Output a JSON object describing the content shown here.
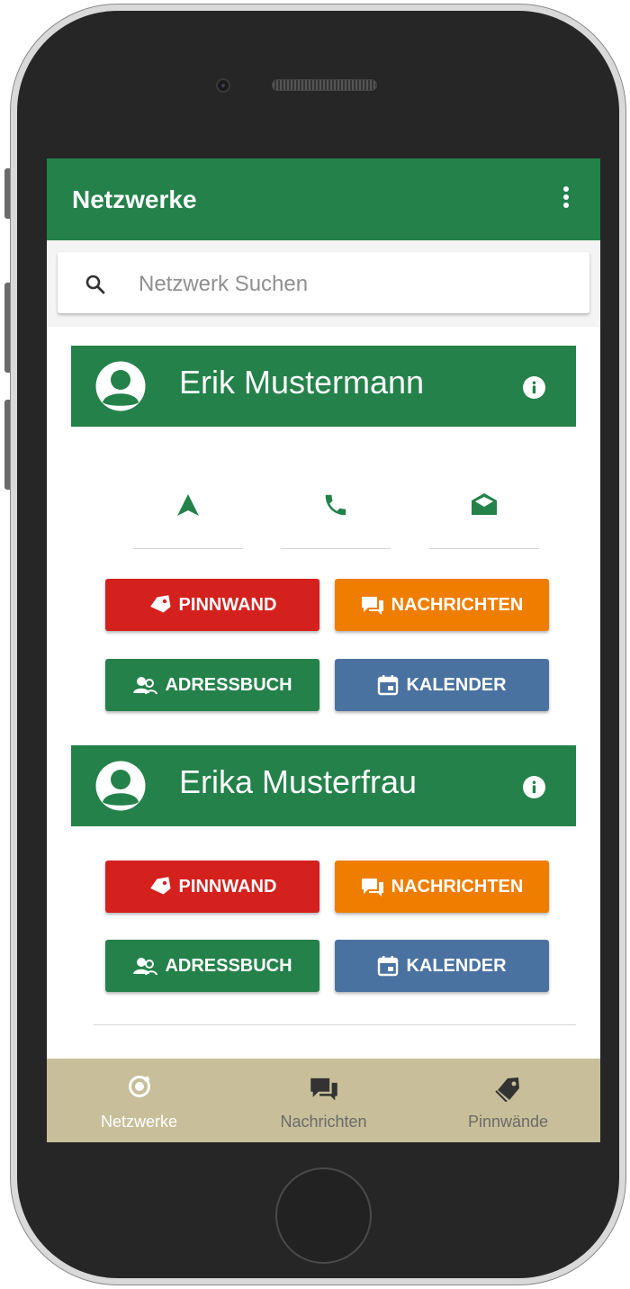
{
  "app": {
    "title": "Netzwerke",
    "menu_icon": "more-vertical-icon",
    "colors": {
      "primary": "#24814a",
      "red": "#d4211e",
      "orange": "#ef7d00",
      "blue": "#4a72a0",
      "tabbar": "#c8bf9a"
    }
  },
  "search": {
    "icon": "search-icon",
    "placeholder": "Netzwerk Suchen"
  },
  "quick_actions": [
    {
      "icon": "navigation-icon"
    },
    {
      "icon": "phone-icon"
    },
    {
      "icon": "mail-open-icon"
    }
  ],
  "people": [
    {
      "name": "Erik Mustermann",
      "buttons": {
        "pinnwand": "PINNWAND",
        "nachrichten": "NACHRICHTEN",
        "adressbuch": "ADRESSBUCH",
        "kalender": "KALENDER"
      }
    },
    {
      "name": "Erika Musterfrau",
      "buttons": {
        "pinnwand": "PINNWAND",
        "nachrichten": "NACHRICHTEN",
        "adressbuch": "ADRESSBUCH",
        "kalender": "KALENDER"
      }
    }
  ],
  "tabs": [
    {
      "label": "Netzwerke",
      "icon": "ionic-icon",
      "active": true
    },
    {
      "label": "Nachrichten",
      "icon": "chat-bubbles-icon",
      "active": false
    },
    {
      "label": "Pinnwände",
      "icon": "tags-icon",
      "active": false
    }
  ]
}
